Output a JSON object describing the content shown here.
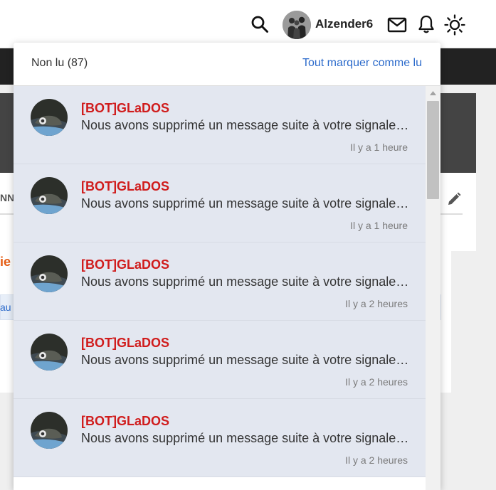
{
  "header": {
    "username": "Alzender6",
    "icons": [
      "search-icon",
      "mail-icon",
      "bell-icon",
      "sun-icon"
    ]
  },
  "background": {
    "card_label": "NN",
    "panel_title": "ie",
    "panel_link": "au"
  },
  "notifications": {
    "title": "Non lu (87)",
    "mark_all_label": "Tout marquer comme lu",
    "items": [
      {
        "author": "[BOT]GLaDOS",
        "message": "Nous avons supprimé un message suite à votre signalement",
        "time": "Il y a 1 heure"
      },
      {
        "author": "[BOT]GLaDOS",
        "message": "Nous avons supprimé un message suite à votre signalement",
        "time": "Il y a 1 heure"
      },
      {
        "author": "[BOT]GLaDOS",
        "message": "Nous avons supprimé un message suite à votre signalement",
        "time": "Il y a 2 heures"
      },
      {
        "author": "[BOT]GLaDOS",
        "message": "Nous avons supprimé un message suite à votre signalement",
        "time": "Il y a 2 heures"
      },
      {
        "author": "[BOT]GLaDOS",
        "message": "Nous avons supprimé un message suite à votre signalement",
        "time": "Il y a 2 heures"
      }
    ]
  },
  "colors": {
    "author": "#d01c1c",
    "link": "#2b6acb",
    "unread_bg": "#e3e7f0",
    "navbar": "#222222"
  }
}
